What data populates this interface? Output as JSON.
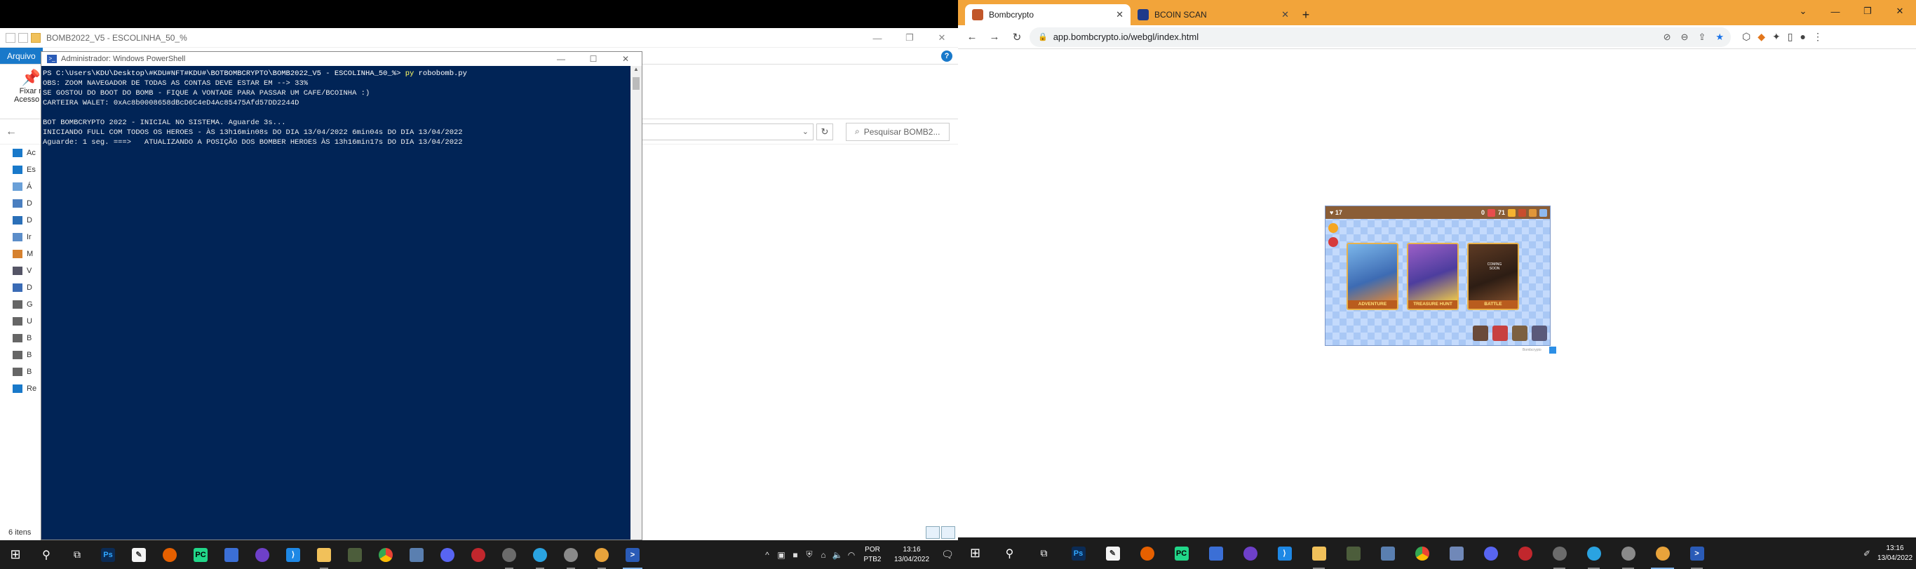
{
  "left_monitor": {
    "explorer": {
      "title": "BOMB2022_V5 - ESCOLINHA_50_%",
      "file_tab": "Arquivo",
      "help_icon": "?",
      "pin_label_1": "Fixar n",
      "pin_label_2": "Acesso rá",
      "search_placeholder": "Pesquisar BOMB2...",
      "status_items": "6 itens",
      "nav_items": [
        "Ac",
        "Es",
        "Á",
        "D",
        "D",
        "Ir",
        "M",
        "V",
        "D",
        "G",
        "U",
        "B",
        "B",
        "B",
        "Re"
      ]
    },
    "powershell": {
      "title": "Administrador: Windows PowerShell",
      "prompt": "PS C:\\Users\\KDU\\Desktop\\#KDU#NFT#KDU#\\BOTBOMBCRYPTO\\BOMB2022_V5 - ESCOLINHA_50_%> ",
      "command_exe": "py",
      "command_arg": " robobomb.py",
      "lines": [
        "OBS: ZOOM NAVEGADOR DE TODAS AS CONTAS DEVE ESTAR EM --> 33%",
        "SE GOSTOU DO BOOT DO BOMB - FIQUE A VONTADE PARA PASSAR UM CAFE/BCOINHA :)",
        "CARTEIRA WALET: 0xAc8b0008658dBcD6C4eD4Ac85475Afd57DD2244D",
        "",
        "BOT BOMBCRYPTO 2022 - INICIAL NO SISTEMA. Aguarde 3s...",
        "INICIANDO FULL COM TODOS OS HEROES - ÀS 13h16min08s DO DIA 13/04/2022 6min04s DO DIA 13/04/2022",
        "Aguarde: 1 seg. ===>   ATUALIZANDO A POSIÇÃO DOS BOMBER HEROES ÀS 13h16min17s DO DIA 13/04/2022"
      ]
    },
    "taskbar": {
      "icons": [
        "windows-icon",
        "search-icon",
        "task-view-icon",
        "photoshop-icon",
        "notepad-icon",
        "firefox-icon",
        "pycharm-icon",
        "app-icon",
        "github-icon",
        "vscode-icon",
        "explorer-icon",
        "app2-icon",
        "chrome-icon",
        "network-icon",
        "discord-icon",
        "app3-icon",
        "chrome-profile-icon",
        "telegram-icon",
        "chrome-profile2-icon",
        "chrome-profile3-icon",
        "powershell-icon"
      ],
      "lang_1": "POR",
      "lang_2": "PTB2",
      "time": "13:16",
      "date": "13/04/2022"
    }
  },
  "right_monitor": {
    "chrome": {
      "tabs": [
        {
          "title": "Bombcrypto",
          "favicon_color": "#c1572a"
        },
        {
          "title": "BCOIN SCAN",
          "favicon_color": "#1e3a8a"
        }
      ],
      "new_tab": "+",
      "url": "app.bombcrypto.io/webgl/index.html",
      "accent": "#f2a43a"
    },
    "game": {
      "top_left": "♥ 17",
      "top_mid": "0",
      "top_right": "71",
      "cards": [
        {
          "caption": "ADVENTURE"
        },
        {
          "caption": "TREASURE HUNT"
        },
        {
          "caption": "BATTLE",
          "badge": "COMING SOON"
        }
      ],
      "footer": "Bombcrypto"
    },
    "taskbar": {
      "time": "13:16",
      "date": "13/04/2022"
    }
  }
}
